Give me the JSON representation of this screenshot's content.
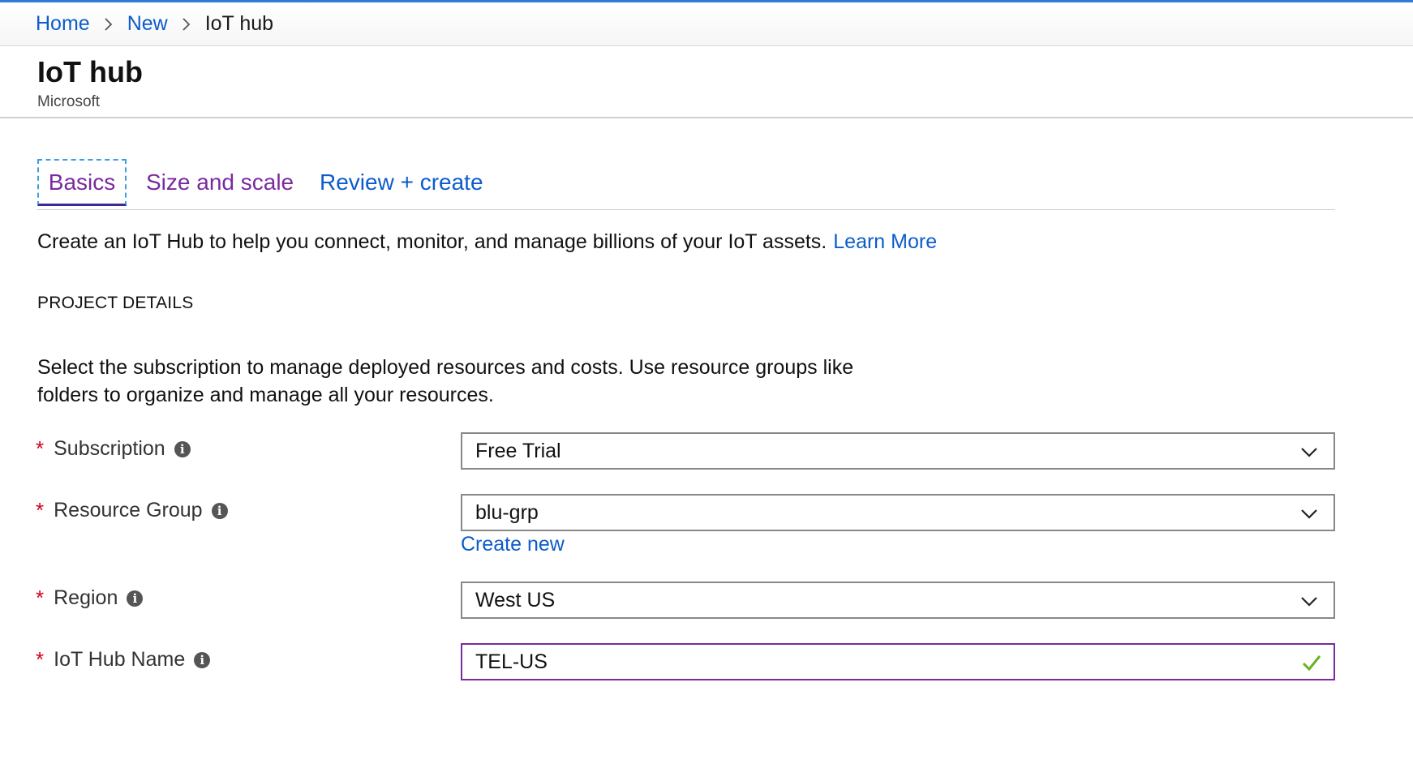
{
  "breadcrumb": {
    "items": [
      {
        "label": "Home"
      },
      {
        "label": "New"
      },
      {
        "label": "IoT hub"
      }
    ]
  },
  "header": {
    "title": "IoT hub",
    "subtitle": "Microsoft"
  },
  "tabs": [
    {
      "label": "Basics",
      "active": true
    },
    {
      "label": "Size and scale"
    },
    {
      "label": "Review + create"
    }
  ],
  "intro": {
    "text": "Create an IoT Hub to help you connect, monitor, and manage billions of your IoT assets.",
    "link": "Learn More"
  },
  "section": {
    "heading": "PROJECT DETAILS",
    "description": "Select the subscription to manage deployed resources and costs. Use resource groups like folders to organize and manage all your resources."
  },
  "form": {
    "required_mark": "*",
    "subscription": {
      "label": "Subscription",
      "value": "Free Trial"
    },
    "resource_group": {
      "label": "Resource Group",
      "value": "blu-grp",
      "create_new": "Create new"
    },
    "region": {
      "label": "Region",
      "value": "West US"
    },
    "hub_name": {
      "label": "IoT Hub Name",
      "value": "TEL-US",
      "valid": true
    }
  },
  "icons": {
    "info": "info-icon",
    "chevron": "chevron-down-icon",
    "check": "check-icon",
    "breadcrumb_sep": "chevron-right-icon"
  },
  "colors": {
    "link": "#0c5ccc",
    "tab_active": "#7a2a9f",
    "required": "#d0021b",
    "valid": "#6bb324",
    "top_accent": "#2f7bd6"
  }
}
